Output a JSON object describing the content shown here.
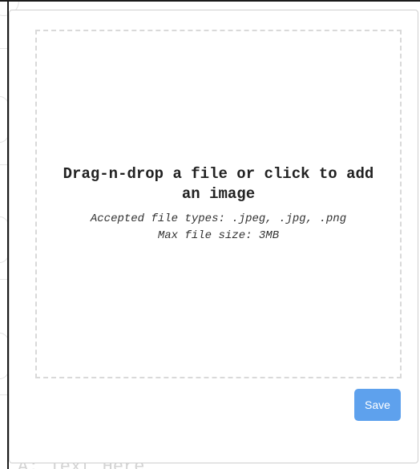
{
  "dropzone": {
    "title": "Drag-n-drop a file or click to add an image",
    "accepted_types": "Accepted file types: .jpeg, .jpg, .png",
    "max_size": "Max file size: 3MB"
  },
  "actions": {
    "save_label": "Save"
  },
  "background": {
    "partial_text": "A: Text Here"
  },
  "colors": {
    "save_button_bg": "#5ea1ed",
    "dropzone_border": "#d9d9d9",
    "modal_border": "#cfcfcf"
  }
}
